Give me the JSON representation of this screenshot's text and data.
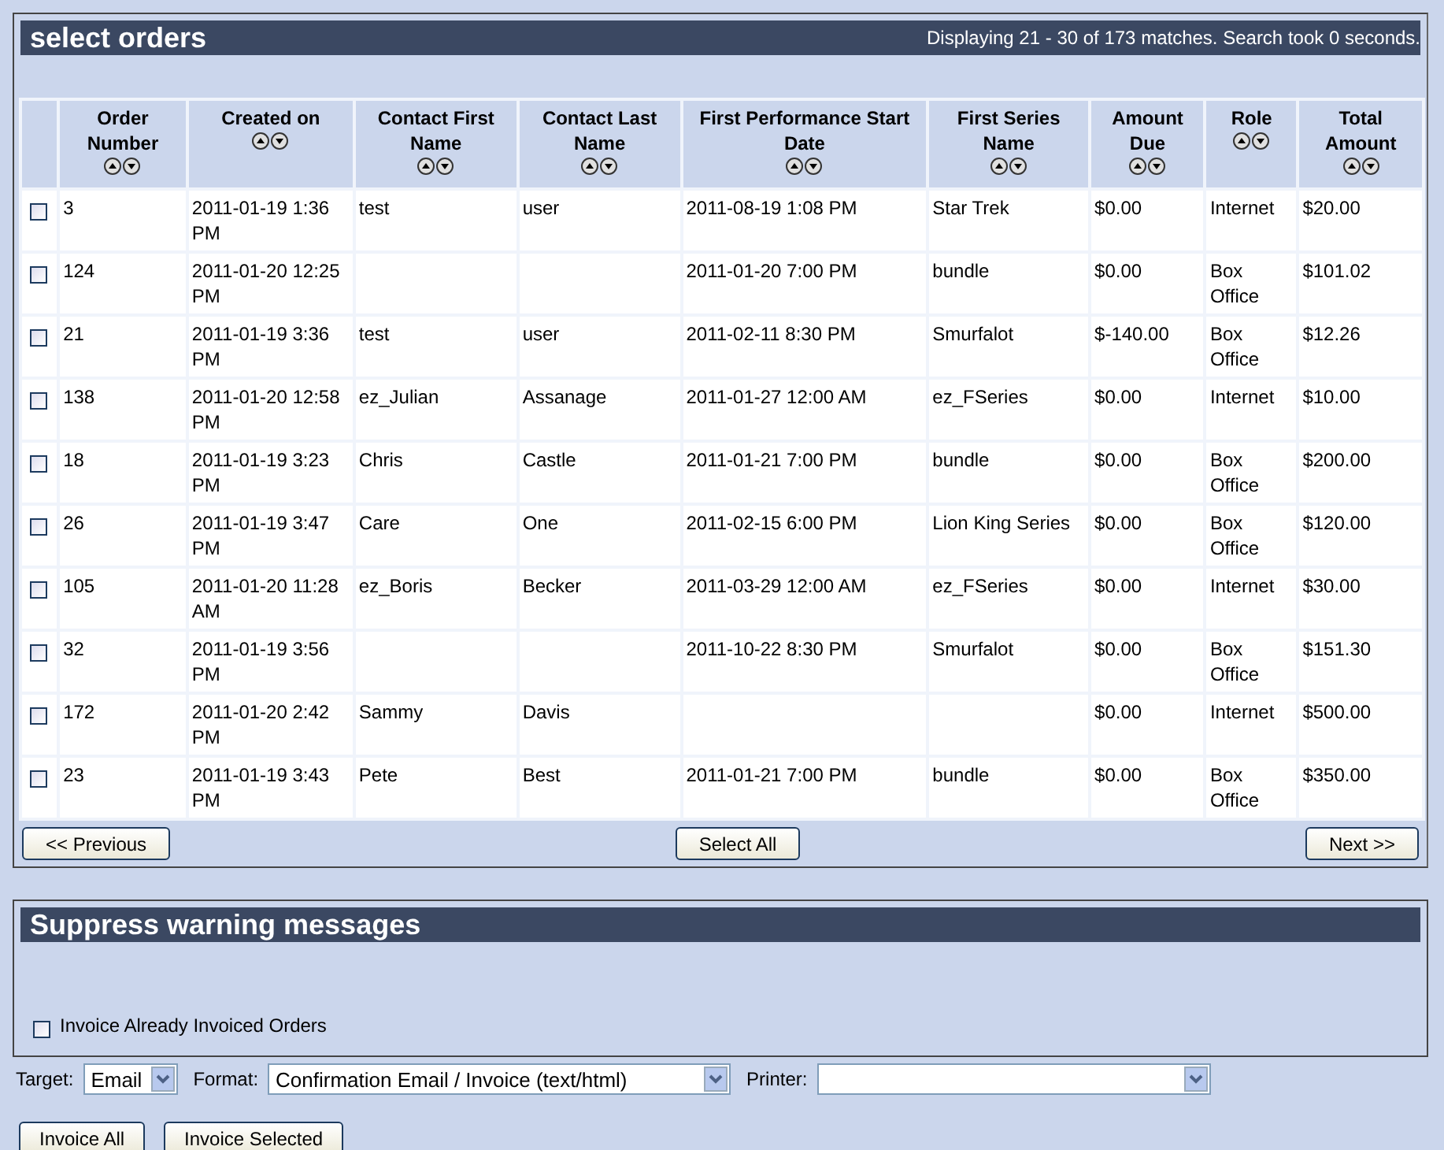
{
  "orders_panel": {
    "title": "select orders",
    "status": "Displaying 21 - 30 of 173 matches. Search took 0 seconds.",
    "columns": [
      "Order Number",
      "Created on",
      "Contact First Name",
      "Contact Last Name",
      "First Performance Start Date",
      "First Series Name",
      "Amount Due",
      "Role",
      "Total Amount"
    ],
    "rows": [
      {
        "checked": false,
        "cells": [
          "3",
          "2011-01-19 1:36 PM",
          "test",
          "user",
          "2011-08-19 1:08 PM",
          "Star Trek",
          "$0.00",
          "Internet",
          "$20.00"
        ]
      },
      {
        "checked": false,
        "cells": [
          "124",
          "2011-01-20 12:25 PM",
          "",
          "",
          "2011-01-20 7:00 PM",
          "bundle",
          "$0.00",
          "Box Office",
          "$101.02"
        ]
      },
      {
        "checked": false,
        "cells": [
          "21",
          "2011-01-19 3:36 PM",
          "test",
          "user",
          "2011-02-11 8:30 PM",
          "Smurfalot",
          "$-140.00",
          "Box Office",
          "$12.26"
        ]
      },
      {
        "checked": false,
        "cells": [
          "138",
          "2011-01-20 12:58 PM",
          "ez_Julian",
          "Assanage",
          "2011-01-27 12:00 AM",
          "ez_FSeries",
          "$0.00",
          "Internet",
          "$10.00"
        ]
      },
      {
        "checked": false,
        "cells": [
          "18",
          "2011-01-19 3:23 PM",
          "Chris",
          "Castle",
          "2011-01-21 7:00 PM",
          "bundle",
          "$0.00",
          "Box Office",
          "$200.00"
        ]
      },
      {
        "checked": false,
        "cells": [
          "26",
          "2011-01-19 3:47 PM",
          "Care",
          "One",
          "2011-02-15 6:00 PM",
          "Lion King Series",
          "$0.00",
          "Box Office",
          "$120.00"
        ]
      },
      {
        "checked": false,
        "cells": [
          "105",
          "2011-01-20 11:28 AM",
          "ez_Boris",
          "Becker",
          "2011-03-29 12:00 AM",
          "ez_FSeries",
          "$0.00",
          "Internet",
          "$30.00"
        ]
      },
      {
        "checked": false,
        "cells": [
          "32",
          "2011-01-19 3:56 PM",
          "",
          "",
          "2011-10-22 8:30 PM",
          "Smurfalot",
          "$0.00",
          "Box Office",
          "$151.30"
        ]
      },
      {
        "checked": false,
        "cells": [
          "172",
          "2011-01-20 2:42 PM",
          "Sammy",
          "Davis",
          "",
          "",
          "$0.00",
          "Internet",
          "$500.00"
        ]
      },
      {
        "checked": false,
        "cells": [
          "23",
          "2011-01-19 3:43 PM",
          "Pete",
          "Best",
          "2011-01-21 7:00 PM",
          "bundle",
          "$0.00",
          "Box Office",
          "$350.00"
        ]
      }
    ],
    "buttons": {
      "previous": "<< Previous",
      "select_all": "Select All",
      "next": "Next >>"
    }
  },
  "warnings_panel": {
    "title": "Suppress warning messages",
    "option": {
      "label": "Invoice Already Invoiced Orders",
      "checked": false
    }
  },
  "options": {
    "target_label": "Target:",
    "target_value": "Email",
    "format_label": "Format:",
    "format_value": "Confirmation Email / Invoice (text/html)",
    "printer_label": "Printer:"
  },
  "actions": [
    "Invoice All",
    "Invoice Selected"
  ]
}
